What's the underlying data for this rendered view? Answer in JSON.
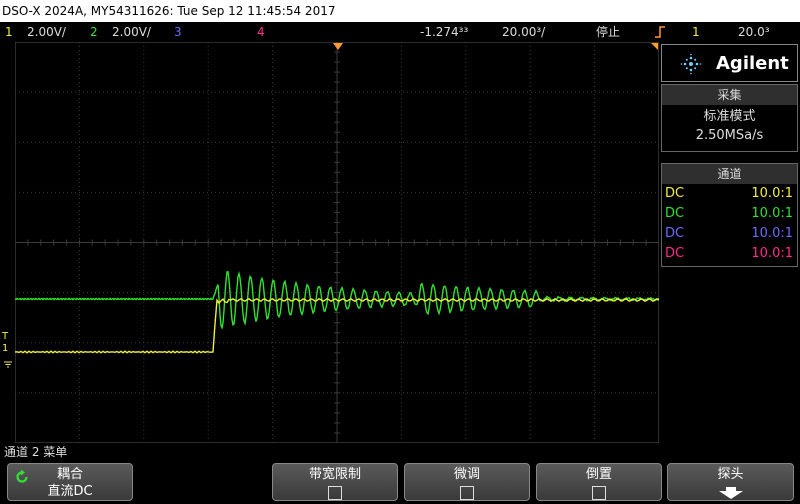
{
  "title_bar": {
    "text": "DSO-X 2024A, MY54311626: Tue Sep 12 11:45:54 2017"
  },
  "status_bar": {
    "ch1_num": "1",
    "ch1_scale": "2.00V/",
    "ch2_num": "2",
    "ch2_scale": "2.00V/",
    "ch3_num": "3",
    "ch4_num": "4",
    "time_delay": "-1.274³³",
    "time_scale": "20.00³/",
    "run_state": "停止",
    "trigger_icon": "trigger-edge-icon",
    "trigger_source": "1",
    "trigger_level": "20.0³"
  },
  "colors": {
    "ch1": "#f2f03a",
    "ch2": "#2fe22f",
    "ch3": "#6a6aff",
    "ch4": "#ff2a8a",
    "grid": "#3a3a3a",
    "marker": "#ff9b2f"
  },
  "brand": {
    "name": "Agilent"
  },
  "acquisition": {
    "header": "采集",
    "mode": "标准模式",
    "rate": "2.50MSa/s"
  },
  "channels_panel": {
    "header": "通道",
    "rows": [
      {
        "coupling": "DC",
        "probe": "10.0:1",
        "color": "#f2f03a"
      },
      {
        "coupling": "DC",
        "probe": "10.0:1",
        "color": "#2fe22f"
      },
      {
        "coupling": "DC",
        "probe": "10.0:1",
        "color": "#6a6aff"
      },
      {
        "coupling": "DC",
        "probe": "10.0:1",
        "color": "#ff2a8a"
      }
    ]
  },
  "menu": {
    "title": "通道 2 菜单",
    "coupling_label": "耦合",
    "coupling_value": "直流DC",
    "bw_limit": "带宽限制",
    "fine": "微调",
    "invert": "倒置",
    "probe": "探头"
  },
  "markers": {
    "trigger": "T",
    "ground": "1"
  }
}
